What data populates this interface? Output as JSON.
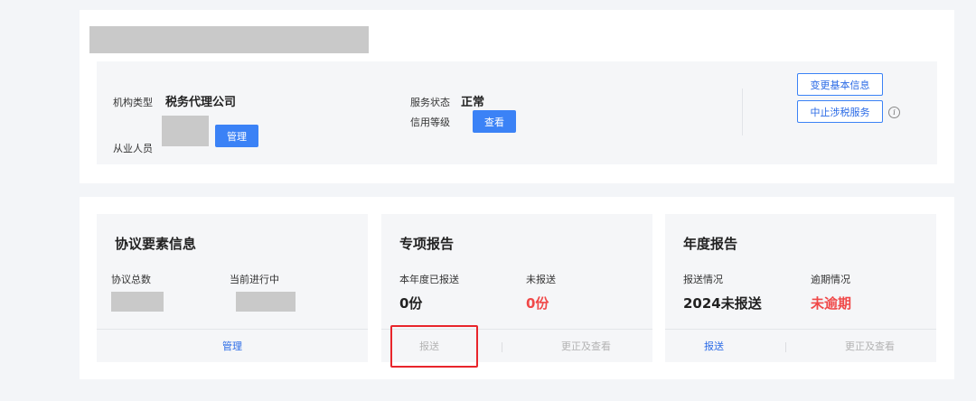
{
  "org": {
    "type_label": "机构类型",
    "type_value": "税务代理公司",
    "staff_label": "从业人员",
    "manage_btn": "管理",
    "service_status_label": "服务状态",
    "service_status_value": "正常",
    "credit_label": "信用等级",
    "view_btn": "查看",
    "change_info_btn": "变更基本信息",
    "suspend_btn": "中止涉税服务",
    "info_icon_glyph": "i"
  },
  "agreement": {
    "title": "协议要素信息",
    "total_label": "协议总数",
    "ongoing_label": "当前进行中",
    "manage_link": "管理"
  },
  "special_report": {
    "title": "专项报告",
    "submitted_label": "本年度已报送",
    "submitted_value": "0份",
    "unsubmitted_label": "未报送",
    "unsubmitted_value": "0份",
    "submit_link": "报送",
    "correct_link": "更正及查看"
  },
  "annual_report": {
    "title": "年度报告",
    "status_label": "报送情况",
    "status_value": "2024未报送",
    "overdue_label": "逾期情况",
    "overdue_value": "未逾期",
    "submit_link": "报送",
    "correct_link": "更正及查看"
  },
  "colors": {
    "primary": "#3b82f6",
    "danger": "#f04848",
    "highlight": "#e8252b"
  }
}
